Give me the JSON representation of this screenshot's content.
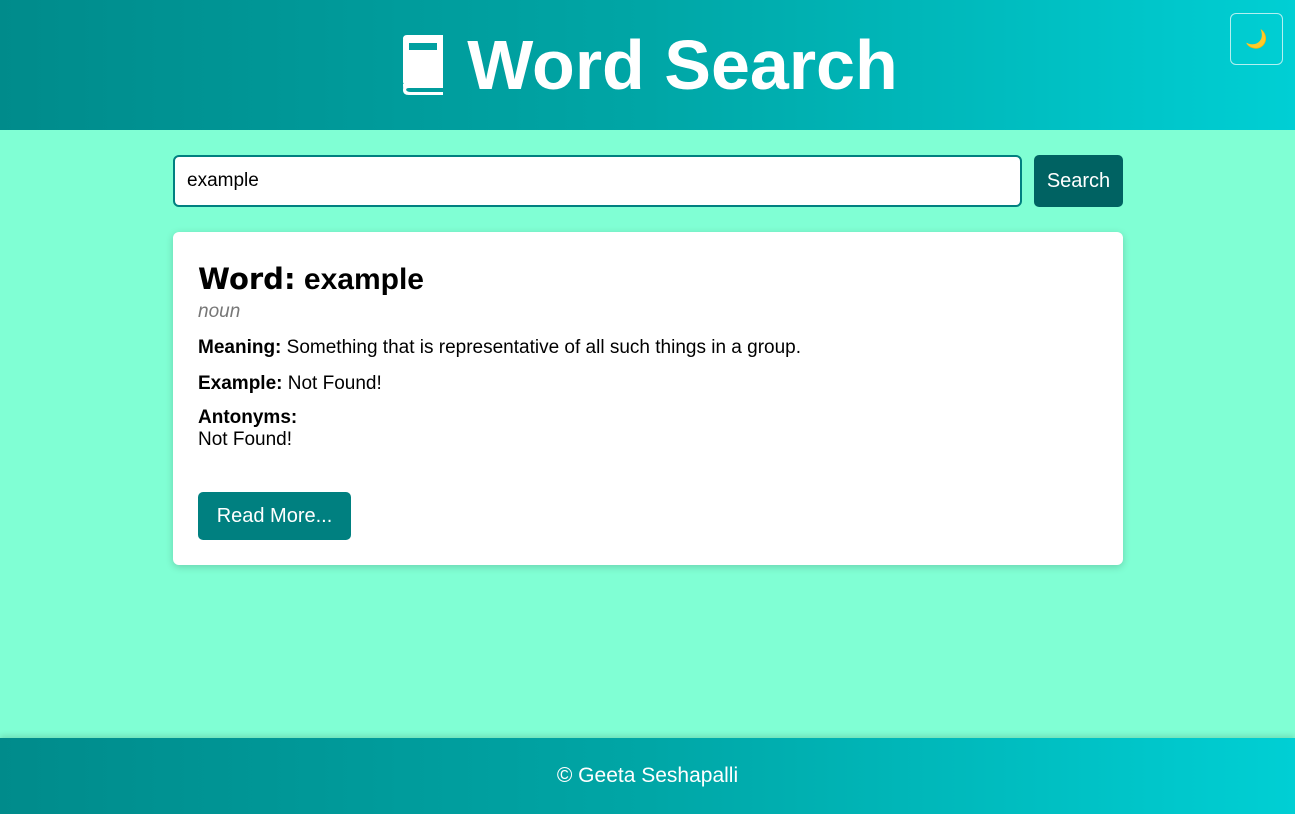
{
  "header": {
    "title": "Word Search",
    "icon": "book-icon",
    "theme_toggle_icon": "moon-icon",
    "theme_toggle_glyph": "🌙"
  },
  "search": {
    "value": "example",
    "button_label": "Search"
  },
  "result": {
    "word_label": "Word:",
    "word": "example",
    "part_of_speech": "noun",
    "meaning_label": "Meaning:",
    "meaning": "Something that is representative of all such things in a group.",
    "example_label": "Example:",
    "example": "Not Found!",
    "antonyms_label": "Antonyms:",
    "antonyms": "Not Found!",
    "read_more_label": "Read More..."
  },
  "footer": {
    "text": "© Geeta Seshapalli"
  },
  "colors": {
    "background": "#80ffd4",
    "header_gradient_start": "#008b8b",
    "header_gradient_end": "#00cfd4",
    "search_button": "#006262",
    "read_more_button": "#008080"
  }
}
